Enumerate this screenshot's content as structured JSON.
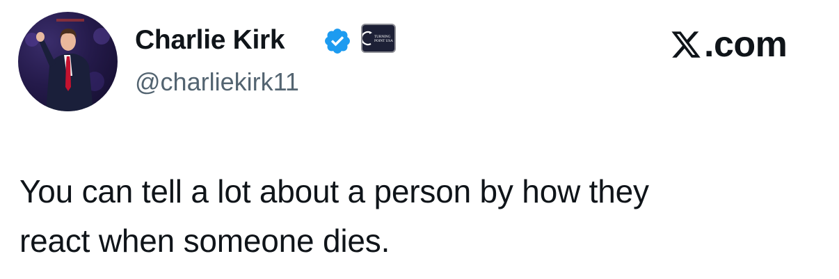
{
  "author": {
    "display_name": "Charlie Kirk",
    "handle": "@charliekirk11",
    "verified_icon": "verified-checkmark-icon",
    "affiliate_badge_icon": "turning-point-usa-logo",
    "affiliate_badge_text": "TURNING POINT USA"
  },
  "brand": {
    "icon": "x-logo-icon",
    "label": ".com"
  },
  "tweet": {
    "text_line_1": "You can tell a lot about a person by how they",
    "text_line_2": "react when someone dies."
  },
  "colors": {
    "verified_blue": "#1d9bf0",
    "handle_gray": "#536471",
    "text": "#0f1419"
  }
}
